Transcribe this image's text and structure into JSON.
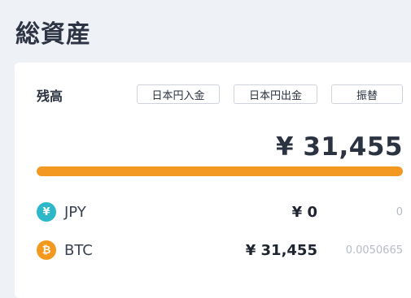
{
  "header": {
    "title": "総資産"
  },
  "balance": {
    "label": "残高",
    "buttons": {
      "deposit": "日本円入金",
      "withdraw": "日本円出金",
      "transfer": "振替"
    },
    "total": "¥ 31,455",
    "allocation_fraction_btc": 1.0,
    "bar_color": "#f39821"
  },
  "assets": [
    {
      "icon": "yen-coin-icon",
      "icon_symbol": "¥",
      "icon_color": "#2cb8c8",
      "name": "JPY",
      "value": "¥ 0",
      "quantity": "0"
    },
    {
      "icon": "bitcoin-coin-icon",
      "icon_symbol": "₿",
      "icon_color": "#f39a1e",
      "name": "BTC",
      "value": "¥ 31,455",
      "quantity": "0.0050665"
    }
  ]
}
